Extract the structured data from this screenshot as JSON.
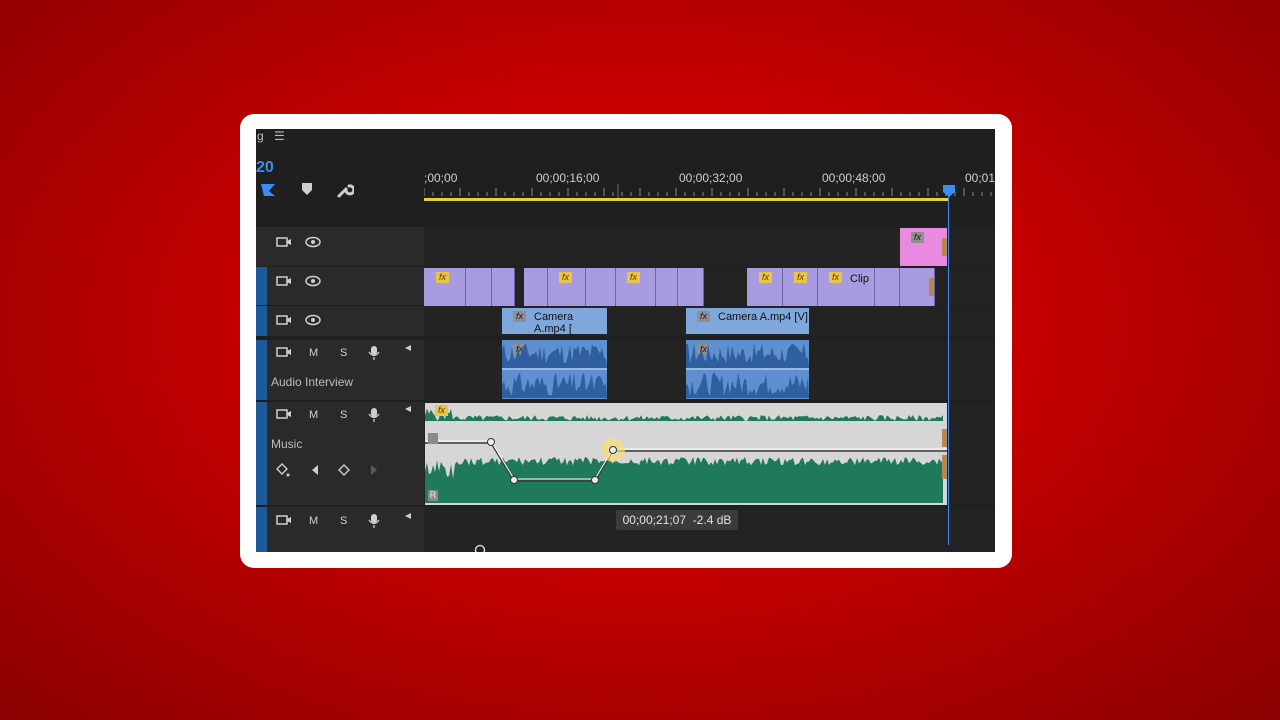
{
  "header": {
    "panel_letter": "g",
    "menu_glyph": "☰",
    "timecode_partial": "20"
  },
  "ruler": {
    "labels": [
      ";00;00",
      "00;00;16;00",
      "00;00;32;00",
      "00;00;48;00",
      "00;01"
    ]
  },
  "tracks": {
    "audio_interview_name": "Audio Interview",
    "music_name": "Music",
    "mute_label": "M",
    "solo_label": "S"
  },
  "clips": {
    "camera_a_1": "Camera A.mp4 [",
    "camera_a_2": "Camera A.mp4 [V]",
    "clip_label": "Clip",
    "fx_label": "fx",
    "right_label": "R"
  },
  "tooltip": {
    "time": "00;00;21;07",
    "gain": "-2.4 dB"
  },
  "colors": {
    "background_red": "#cc0000",
    "playhead_blue": "#3b8ef0",
    "work_area_yellow": "#e8d23a",
    "video_clip_purple": "#a99bdf",
    "adjustment_clip_pink": "#e88ae0",
    "camera_clip_blue": "#7fa7db",
    "music_waveform_green": "#1e7a5a"
  }
}
